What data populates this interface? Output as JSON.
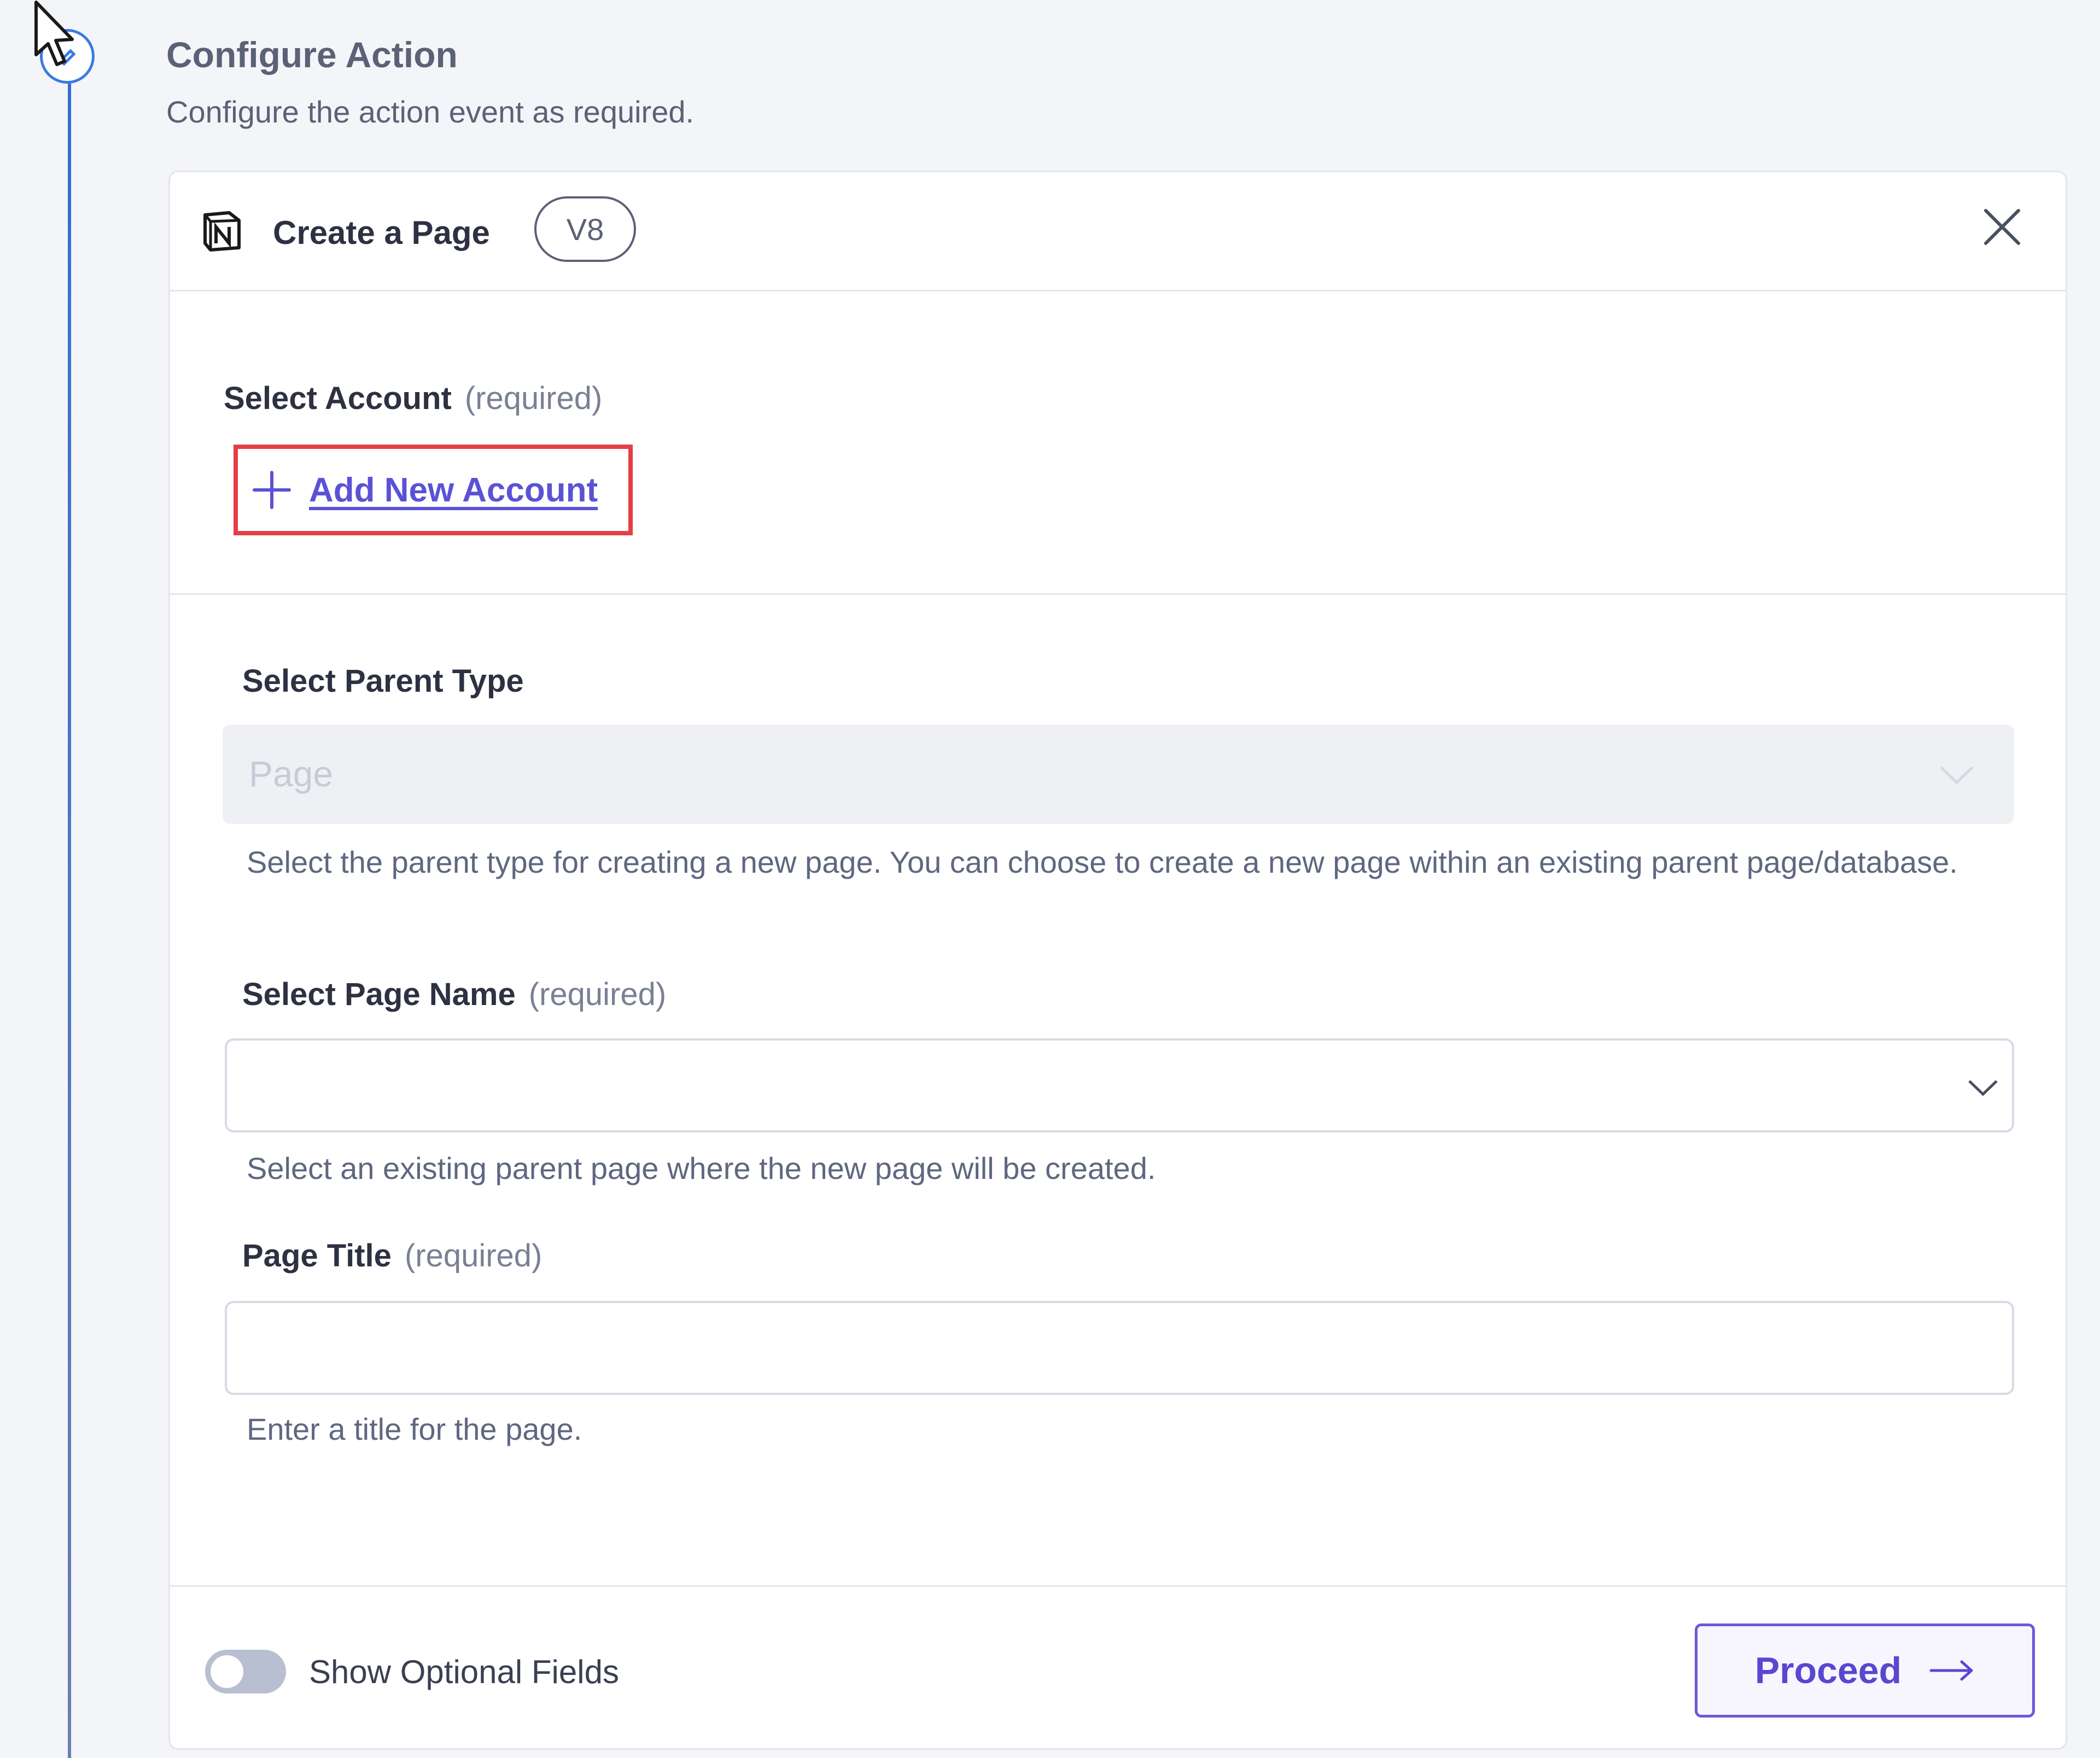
{
  "header": {
    "title": "Configure Action",
    "subtitle": "Configure the action event as required."
  },
  "card": {
    "app_icon": "notion-logo-icon",
    "title": "Create a Page",
    "version": "V8"
  },
  "account": {
    "label": "Select Account",
    "required": "(required)",
    "add_link": "Add New Account"
  },
  "parent_type": {
    "label": "Select Parent Type",
    "value": "Page",
    "help": "Select the parent type for creating a new page. You can choose to create a new page within an existing parent page/database."
  },
  "page_name": {
    "label": "Select Page Name",
    "required": "(required)",
    "value": "",
    "help": "Select an existing parent page where the new page will be created."
  },
  "page_title": {
    "label": "Page Title",
    "required": "(required)",
    "value": "",
    "help": "Enter a title for the page."
  },
  "footer": {
    "toggle_label": "Show Optional Fields",
    "toggle_on": false,
    "proceed_label": "Proceed"
  },
  "colors": {
    "accent": "#5a47cf",
    "highlight": "#e53e45",
    "timeline": "#2f6fd6"
  }
}
